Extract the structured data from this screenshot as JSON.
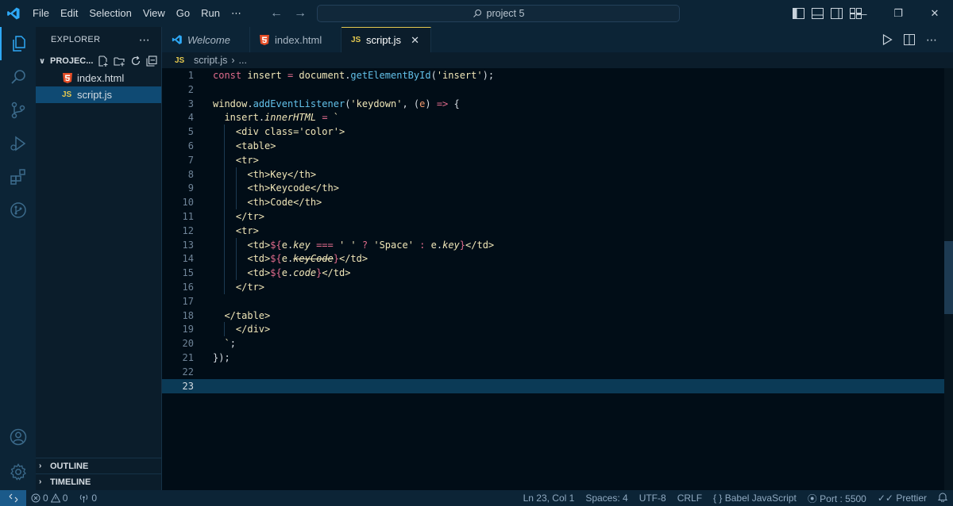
{
  "titlebar": {
    "menu": [
      "File",
      "Edit",
      "Selection",
      "View",
      "Go",
      "Run",
      "⋯"
    ],
    "search_text": "project 5"
  },
  "sidebar": {
    "title": "EXPLORER",
    "project": "PROJEC...",
    "files": [
      {
        "name": "index.html",
        "type": "html"
      },
      {
        "name": "script.js",
        "type": "js"
      }
    ],
    "outline": "OUTLINE",
    "timeline": "TIMELINE"
  },
  "tabs": [
    {
      "label": "Welcome",
      "icon": "vscode-icon"
    },
    {
      "label": "index.html",
      "icon": "html-icon"
    },
    {
      "label": "script.js",
      "icon": "js-icon",
      "active": true
    }
  ],
  "breadcrumb": {
    "file": "script.js",
    "rest": "..."
  },
  "editor": {
    "js_badge": "JS",
    "current_line": 23,
    "line_numbers": [
      "1",
      "2",
      "3",
      "4",
      "5",
      "6",
      "7",
      "8",
      "9",
      "10",
      "11",
      "12",
      "13",
      "14",
      "15",
      "16",
      "17",
      "18",
      "19",
      "20",
      "21",
      "22",
      "23"
    ]
  },
  "code_lines": [
    [
      [
        "k-decl",
        "const "
      ],
      [
        "k-var",
        "insert "
      ],
      [
        "k-op",
        "= "
      ],
      [
        "k-obj",
        "document"
      ],
      [
        "k-punc",
        "."
      ],
      [
        "k-fn",
        "getElementById"
      ],
      [
        "k-punc",
        "("
      ],
      [
        "k-str",
        "'insert'"
      ],
      [
        "k-punc",
        ");"
      ]
    ],
    [],
    [
      [
        "k-obj",
        "window"
      ],
      [
        "k-punc",
        "."
      ],
      [
        "k-fn",
        "addEventListener"
      ],
      [
        "k-punc",
        "("
      ],
      [
        "k-str",
        "'keydown'"
      ],
      [
        "k-punc",
        ", ("
      ],
      [
        "k-param",
        "e"
      ],
      [
        "k-punc",
        ") "
      ],
      [
        "k-op",
        "=>"
      ],
      [
        "k-punc",
        " {"
      ]
    ],
    [
      [
        "k-punc",
        "  "
      ],
      [
        "k-obj",
        "insert"
      ],
      [
        "k-punc",
        "."
      ],
      [
        "k-prop",
        "innerHTML"
      ],
      [
        "k-punc",
        " "
      ],
      [
        "k-op",
        "="
      ],
      [
        "k-punc",
        " "
      ],
      [
        "k-tpl",
        "`"
      ]
    ],
    [
      [
        "k-tpl",
        "    <div class='color'>"
      ]
    ],
    [
      [
        "k-tpl",
        "    <table>"
      ]
    ],
    [
      [
        "k-tpl",
        "    <tr>"
      ]
    ],
    [
      [
        "k-tpl",
        "      <th>Key</th>"
      ]
    ],
    [
      [
        "k-tpl",
        "      <th>Keycode</th>"
      ]
    ],
    [
      [
        "k-tpl",
        "      <th>Code</th>"
      ]
    ],
    [
      [
        "k-tpl",
        "    </tr>"
      ]
    ],
    [
      [
        "k-tpl",
        "    <tr>"
      ]
    ],
    [
      [
        "k-tpl",
        "      <td>"
      ],
      [
        "k-op",
        "${"
      ],
      [
        "k-var",
        "e"
      ],
      [
        "k-punc",
        "."
      ],
      [
        "k-prop",
        "key"
      ],
      [
        "k-op",
        " === "
      ],
      [
        "k-str",
        "' '"
      ],
      [
        "k-op",
        " ? "
      ],
      [
        "k-str",
        "'Space'"
      ],
      [
        "k-op",
        " : "
      ],
      [
        "k-var",
        "e"
      ],
      [
        "k-punc",
        "."
      ],
      [
        "k-prop",
        "key"
      ],
      [
        "k-op",
        "}"
      ],
      [
        "k-tpl",
        "</td>"
      ]
    ],
    [
      [
        "k-tpl",
        "      <td>"
      ],
      [
        "k-op",
        "${"
      ],
      [
        "k-var",
        "e"
      ],
      [
        "k-punc",
        "."
      ],
      [
        "k-strike",
        "keyCode"
      ],
      [
        "k-op",
        "}"
      ],
      [
        "k-tpl",
        "</td>"
      ]
    ],
    [
      [
        "k-tpl",
        "      <td>"
      ],
      [
        "k-op",
        "${"
      ],
      [
        "k-var",
        "e"
      ],
      [
        "k-punc",
        "."
      ],
      [
        "k-prop",
        "code"
      ],
      [
        "k-op",
        "}"
      ],
      [
        "k-tpl",
        "</td>"
      ]
    ],
    [
      [
        "k-tpl",
        "    </tr>"
      ]
    ],
    [],
    [
      [
        "k-tpl",
        "  </table>"
      ]
    ],
    [
      [
        "k-tpl",
        "    </div>"
      ]
    ],
    [
      [
        "k-tpl",
        "  `"
      ],
      [
        "k-punc",
        ";"
      ]
    ],
    [
      [
        "k-punc",
        "});"
      ]
    ],
    [],
    []
  ],
  "statusbar": {
    "errors": "0",
    "warnings": "0",
    "ports": "0",
    "position": "Ln 23, Col 1",
    "spaces": "Spaces: 4",
    "encoding": "UTF-8",
    "eol": "CRLF",
    "language": "Babel JavaScript",
    "port": "Port : 5500",
    "prettier": "Prettier"
  },
  "colors": {
    "accent": "#2ea8f5",
    "js_yellow": "#e5c94f",
    "html_orange": "#e44d26",
    "keyword": "#e06b8c",
    "function": "#63c0e8"
  }
}
